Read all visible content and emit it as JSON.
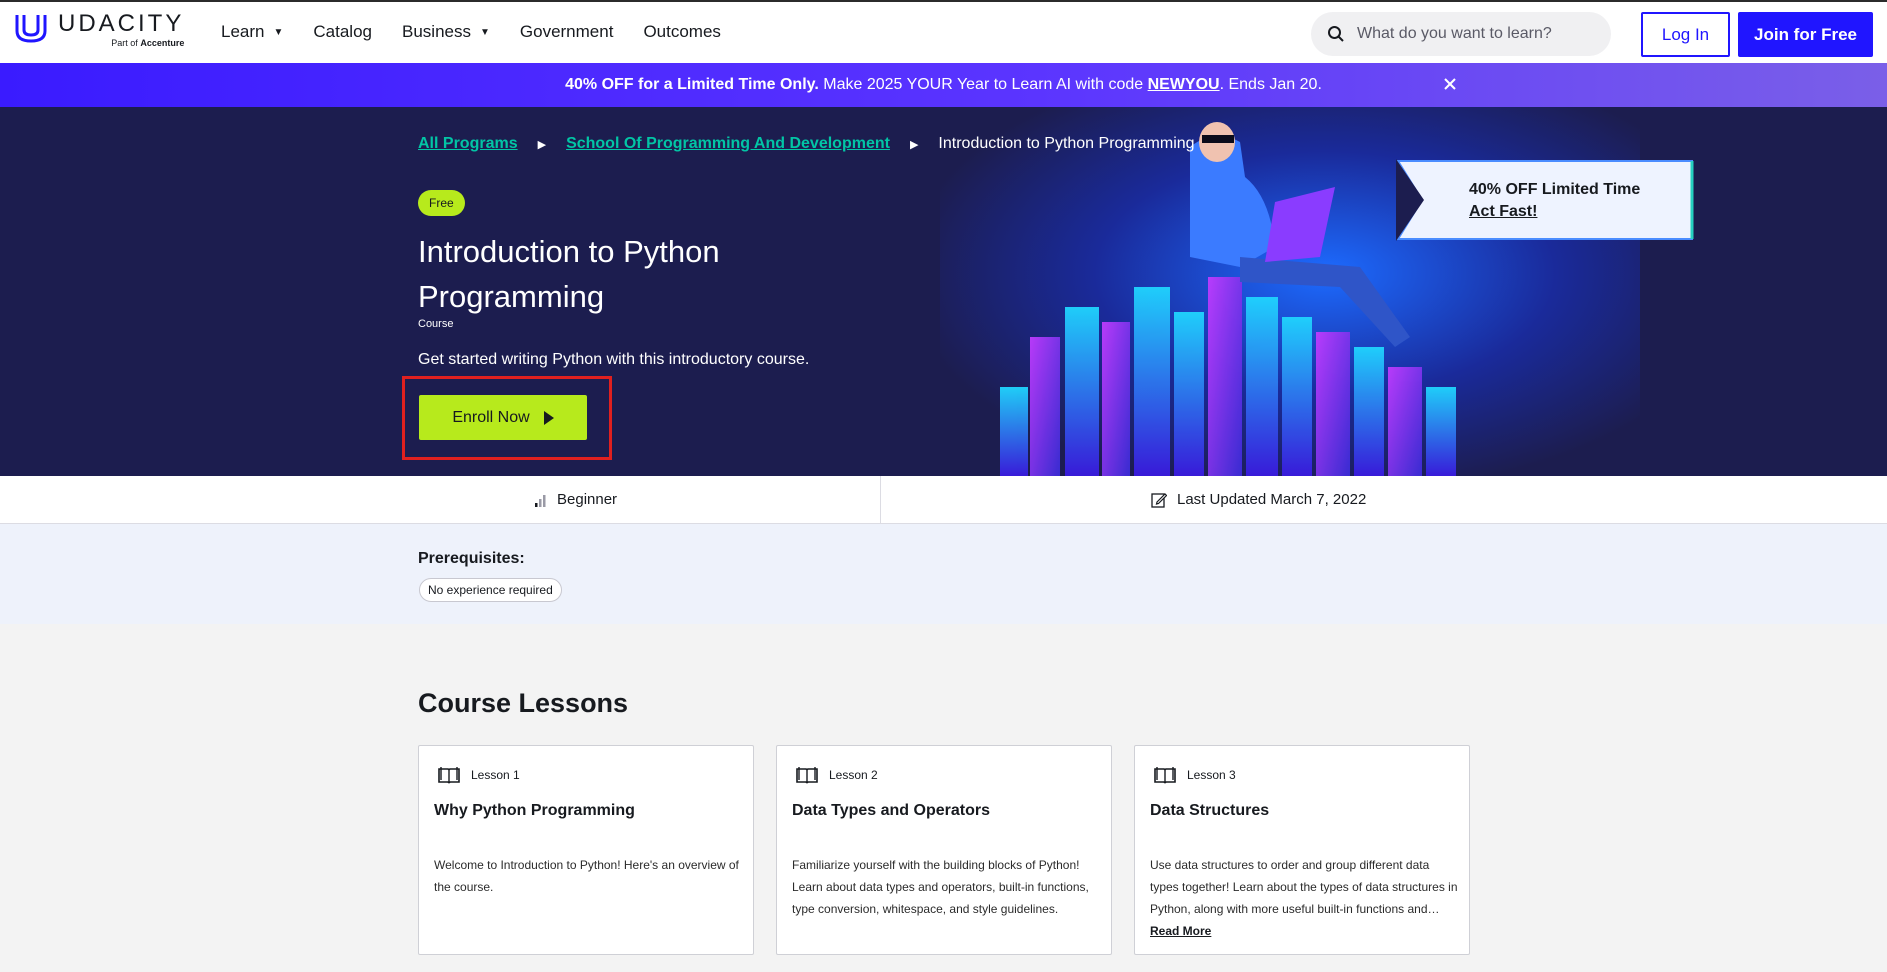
{
  "header": {
    "logo_text": "UDACITY",
    "logo_sub_prefix": "Part of",
    "logo_sub_brand": "Accenture",
    "nav": [
      {
        "label": "Learn",
        "has_caret": true
      },
      {
        "label": "Catalog",
        "has_caret": false
      },
      {
        "label": "Business",
        "has_caret": true
      },
      {
        "label": "Government",
        "has_caret": false
      },
      {
        "label": "Outcomes",
        "has_caret": false
      }
    ],
    "search_placeholder": "What do you want to learn?",
    "login_label": "Log In",
    "join_label": "Join for Free"
  },
  "promo": {
    "bold": "40% OFF for a Limited Time Only.",
    "text_before_code": " Make 2025 YOUR Year to Learn AI with code ",
    "code": "NEWYOU",
    "text_after_code": ". Ends Jan 20."
  },
  "hero": {
    "breadcrumb": [
      {
        "label": "All Programs",
        "link": true
      },
      {
        "label": "School Of Programming And Development",
        "link": true
      },
      {
        "label": "Introduction to Python Programming",
        "link": false
      }
    ],
    "badge": "Free",
    "title": "Introduction to Python Programming",
    "type": "Course",
    "description": "Get started writing Python with this introductory course.",
    "enroll_label": "Enroll Now",
    "offer_line1": "40% OFF Limited Time",
    "offer_line2": "Act Fast!"
  },
  "info": {
    "level": "Beginner",
    "updated": "Last Updated March 7, 2022"
  },
  "prereq": {
    "label": "Prerequisites:",
    "chip": "No experience required"
  },
  "lessons": {
    "title": "Course Lessons",
    "items": [
      {
        "number": "Lesson 1",
        "title": "Why Python Programming",
        "description": "Welcome to Introduction to Python! Here's an overview of the course."
      },
      {
        "number": "Lesson 2",
        "title": "Data Types and Operators",
        "description": "Familiarize yourself with the building blocks of Python! Learn about data types and operators, built-in functions, type conversion, whitespace, and style guidelines."
      },
      {
        "number": "Lesson 3",
        "title": "Data Structures",
        "description": "Use data structures to order and group different data types together! Learn about the types of data structures in Python, along with more useful built-in functions and operators.",
        "read_more": "Read More"
      }
    ]
  },
  "colors": {
    "brand_blue": "#2015ff",
    "hero_bg": "#1c1d4f",
    "accent_green": "#b7ea1c",
    "link_teal": "#02c5a5",
    "highlight_red": "#e0201f"
  }
}
